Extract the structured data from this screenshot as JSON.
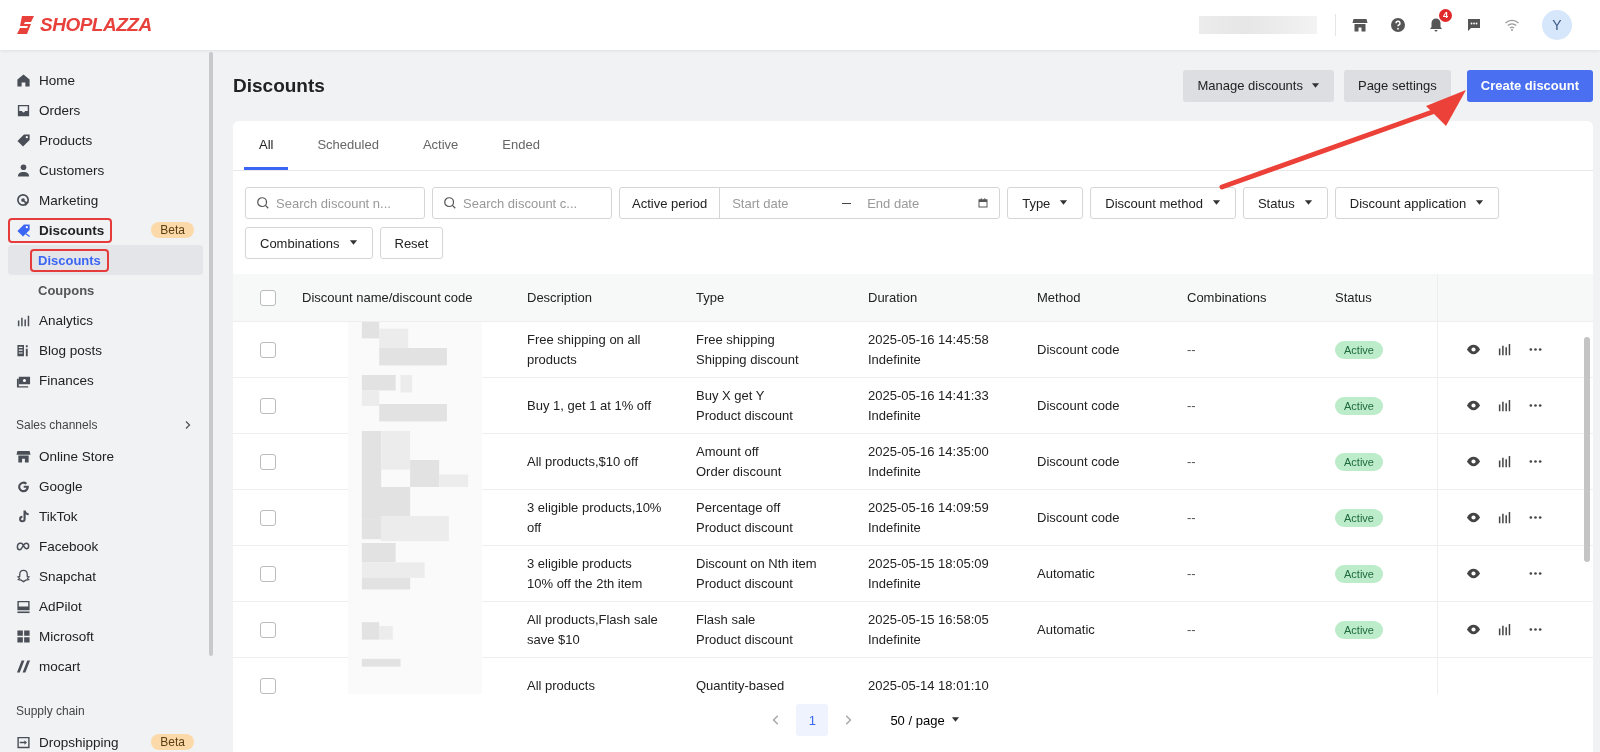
{
  "brand": {
    "name": "SHOPLAZZA"
  },
  "top_bar": {
    "notification_count": "4",
    "avatar": "Y"
  },
  "sidebar": {
    "sections": [
      {
        "items": [
          {
            "label": "Home",
            "selected": false,
            "highlighted": false
          },
          {
            "label": "Orders",
            "selected": false,
            "highlighted": false
          },
          {
            "label": "Products",
            "selected": false,
            "highlighted": false
          },
          {
            "label": "Customers",
            "selected": false,
            "highlighted": false
          },
          {
            "label": "Marketing",
            "selected": false,
            "highlighted": false
          },
          {
            "label": "Discounts",
            "selected": true,
            "highlighted": true,
            "badge": "Beta",
            "children": [
              {
                "label": "Discounts",
                "selected": true,
                "highlighted": true
              },
              {
                "label": "Coupons",
                "selected": false,
                "highlighted": false
              }
            ]
          },
          {
            "label": "Analytics",
            "selected": false,
            "highlighted": false
          },
          {
            "label": "Blog posts",
            "selected": false,
            "highlighted": false
          },
          {
            "label": "Finances",
            "selected": false,
            "highlighted": false
          }
        ]
      },
      {
        "heading": "Sales channels",
        "items": [
          {
            "label": "Online Store",
            "selected": false,
            "highlighted": false
          },
          {
            "label": "Google",
            "selected": false,
            "highlighted": false
          },
          {
            "label": "TikTok",
            "selected": false,
            "highlighted": false
          },
          {
            "label": "Facebook",
            "selected": false,
            "highlighted": false
          },
          {
            "label": "Snapchat",
            "selected": false,
            "highlighted": false
          },
          {
            "label": "AdPilot",
            "selected": false,
            "highlighted": false
          },
          {
            "label": "Microsoft",
            "selected": false,
            "highlighted": false
          },
          {
            "label": "mocart",
            "selected": false,
            "highlighted": false
          }
        ]
      },
      {
        "heading": "Supply chain",
        "items": [
          {
            "label": "Dropshipping",
            "selected": false,
            "highlighted": false,
            "badge": "Beta"
          }
        ]
      }
    ]
  },
  "page": {
    "title": "Discounts",
    "buttons": [
      {
        "label": "Manage discounts",
        "kind": "dropdown"
      },
      {
        "label": "Page settings",
        "kind": "secondary"
      },
      {
        "label": "Create discount",
        "kind": "primary"
      }
    ]
  },
  "tabs": [
    {
      "label": "All",
      "selected": true
    },
    {
      "label": "Scheduled",
      "selected": false
    },
    {
      "label": "Active",
      "selected": false
    },
    {
      "label": "Ended",
      "selected": false
    }
  ],
  "filters": [
    {
      "kind": "search",
      "placeholder": "Search discount n..."
    },
    {
      "kind": "search",
      "placeholder": "Search discount c..."
    },
    {
      "kind": "daterange",
      "label": "Active period",
      "start_placeholder": "Start date",
      "end_placeholder": "End date"
    },
    {
      "kind": "dropdown",
      "label": "Type"
    },
    {
      "kind": "dropdown",
      "label": "Discount method"
    },
    {
      "kind": "dropdown",
      "label": "Status"
    },
    {
      "kind": "dropdown",
      "label": "Discount application"
    },
    {
      "kind": "dropdown",
      "label": "Combinations"
    },
    {
      "kind": "button",
      "label": "Reset"
    }
  ],
  "table": {
    "select_all": {
      "checked": false
    },
    "columns": [
      "Discount name/discount code",
      "Description",
      "Type",
      "Duration",
      "Method",
      "Combinations",
      "Status"
    ],
    "rows": [
      {
        "checked": false,
        "description": [
          "Free shipping on all",
          "products"
        ],
        "type": [
          "Free shipping",
          "Shipping discount"
        ],
        "duration": [
          "2025-05-16 14:45:58",
          "Indefinite"
        ],
        "method": "Discount code",
        "combinations": "--",
        "status": "Active",
        "view": true,
        "stats": true,
        "more": true
      },
      {
        "checked": false,
        "description": [
          "Buy 1, get 1 at 1% off"
        ],
        "type": [
          "Buy X get Y",
          "Product discount"
        ],
        "duration": [
          "2025-05-16 14:41:33",
          "Indefinite"
        ],
        "method": "Discount code",
        "combinations": "--",
        "status": "Active",
        "view": true,
        "stats": true,
        "more": true
      },
      {
        "checked": false,
        "description": [
          "All products,$10 off"
        ],
        "type": [
          "Amount off",
          "Order discount"
        ],
        "duration": [
          "2025-05-16 14:35:00",
          "Indefinite"
        ],
        "method": "Discount code",
        "combinations": "--",
        "status": "Active",
        "view": true,
        "stats": true,
        "more": true
      },
      {
        "checked": false,
        "description": [
          "3 eligible products,10%",
          "off"
        ],
        "type": [
          "Percentage off",
          "Product discount"
        ],
        "duration": [
          "2025-05-16 14:09:59",
          "Indefinite"
        ],
        "method": "Discount code",
        "combinations": "--",
        "status": "Active",
        "view": true,
        "stats": true,
        "more": true
      },
      {
        "checked": false,
        "description": [
          "3 eligible products",
          "10% off the 2th item"
        ],
        "type": [
          "Discount on Nth item",
          "Product discount"
        ],
        "duration": [
          "2025-05-15 18:05:09",
          "Indefinite"
        ],
        "method": "Automatic",
        "combinations": "--",
        "status": "Active",
        "view": true,
        "stats": false,
        "more": true
      },
      {
        "checked": false,
        "description": [
          "All products,Flash sale",
          "save $10"
        ],
        "type": [
          "Flash sale",
          "Product discount"
        ],
        "duration": [
          "2025-05-15 16:58:05",
          "Indefinite"
        ],
        "method": "Automatic",
        "combinations": "--",
        "status": "Active",
        "view": true,
        "stats": true,
        "more": true
      },
      {
        "checked": false,
        "description": [
          "All products"
        ],
        "type": [
          "Quantity-based"
        ],
        "duration": [
          "2025-05-14 18:01:10"
        ],
        "view": false,
        "stats": false,
        "more": false
      }
    ]
  },
  "pagination": {
    "pages": [
      {
        "label": "1",
        "selected": true
      }
    ],
    "page_size": "50 / page"
  }
}
